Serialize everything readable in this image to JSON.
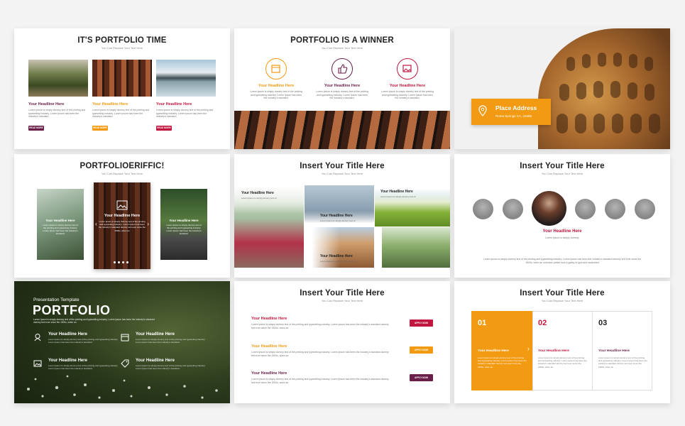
{
  "colors": {
    "orange": "#f29a12",
    "crimson": "#c0163f",
    "plum": "#6a1f4a",
    "dark": "#222222"
  },
  "sub": "You Can Replace Your Text Here",
  "lorem_short": "Lorem Ipsum is simply dummy text of the printing and typesetting industry. Lorem Ipsum has been the industry's standard.",
  "lorem_long": "Lorem Ipsum is simply dummy text of the printing and typesetting industry. Lorem Ipsum has been the industry's standard dummy text ever since the 1500s, when an",
  "slide1": {
    "title": "IT'S PORTFOLIO TIME",
    "cards": [
      {
        "headline": "Your Headline Here",
        "button": "READ MORE"
      },
      {
        "headline": "Your Headline Here",
        "button": "READ MORE"
      },
      {
        "headline": "Your Headline Here",
        "button": "READ MORE"
      }
    ]
  },
  "slide2": {
    "title": "PORTFOLIO IS A WINNER",
    "items": [
      {
        "icon": "calendar-icon",
        "headline": "Your Headline Here"
      },
      {
        "icon": "thumbs-up-icon",
        "headline": "Your Headline Here"
      },
      {
        "icon": "image-icon",
        "headline": "Your Headline Here"
      }
    ]
  },
  "slide3": {
    "place_title": "Place Address",
    "place_line": "Roma Springs CA, 34566"
  },
  "slide4": {
    "title": "PORTFOLIOERIFFIC!",
    "left_headline": "Your Headline Here",
    "center_headline": "Your Headline Here",
    "right_headline": "Your Headline Here",
    "prev": "‹",
    "next": "›"
  },
  "slide5": {
    "title": "Insert Your Title Here",
    "labels": [
      "Your Headline Here",
      "Your Headline Here",
      "Your Headline Here",
      "Your Headline Here"
    ],
    "caption": "Lorem Ipsum is simply dummy text of"
  },
  "slide6": {
    "title": "Insert Your Title Here",
    "headline": "Your Headline Here",
    "caption": "Lorem Ipsum is simply dummy.",
    "footer": "Lorem Ipsum is simply dummy text of the printing and typesetting industry. Lorem Ipsum has been the industry's standard dummy text ever since the 1500s, when an unknown printer took a galley of type and scrambled"
  },
  "slide7": {
    "small": "Presentation Template",
    "big": "PORTFOLIO",
    "items": [
      {
        "icon": "person-pin-icon",
        "headline": "Your Headline Here"
      },
      {
        "icon": "calendar-icon",
        "headline": "Your Headline Here"
      },
      {
        "icon": "image-icon",
        "headline": "Your Headline Here"
      },
      {
        "icon": "tag-icon",
        "headline": "Your Headline Here"
      }
    ]
  },
  "slide8": {
    "title": "Insert Your Title Here",
    "rows": [
      {
        "headline": "Your Headline Here",
        "button": "APPLY NOW"
      },
      {
        "headline": "Your Headline Here",
        "button": "APPLY NOW"
      },
      {
        "headline": "Your Headline Here",
        "button": "APPLY NOW"
      }
    ]
  },
  "slide9": {
    "title": "Insert Your Title Here",
    "cols": [
      {
        "num": "01",
        "headline": "Your Headline Here"
      },
      {
        "num": "02",
        "headline": "Your Headline Here"
      },
      {
        "num": "03",
        "headline": "Your Headline Here"
      }
    ],
    "arrow": "›"
  }
}
